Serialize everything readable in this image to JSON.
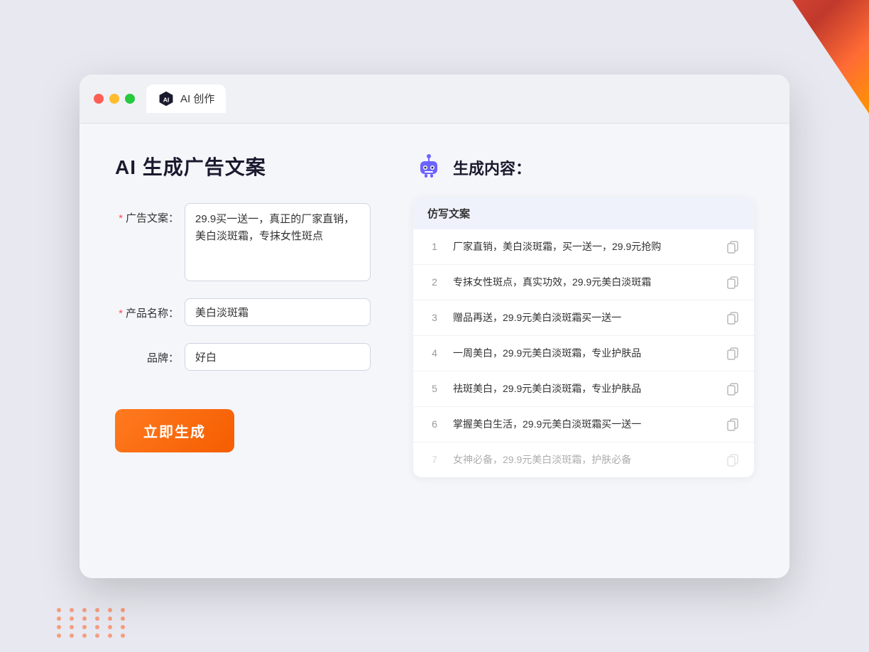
{
  "window": {
    "title": "AI 创作",
    "tab_title": "AI 创作"
  },
  "page": {
    "title": "AI 生成广告文案",
    "result_title": "生成内容："
  },
  "form": {
    "ad_copy_label": "广告文案：",
    "ad_copy_required": "＊",
    "ad_copy_value": "29.9买一送一，真正的厂家直销，美白淡斑霜，专抹女性斑点",
    "product_name_label": "产品名称：",
    "product_name_required": "＊",
    "product_name_value": "美白淡斑霜",
    "brand_label": "品牌：",
    "brand_value": "好白",
    "submit_label": "立即生成"
  },
  "results": {
    "table_header": "仿写文案",
    "rows": [
      {
        "num": "1",
        "text": "厂家直销，美白淡斑霜，买一送一，29.9元抢购",
        "faded": false
      },
      {
        "num": "2",
        "text": "专抹女性斑点，真实功效，29.9元美白淡斑霜",
        "faded": false
      },
      {
        "num": "3",
        "text": "赠品再送，29.9元美白淡斑霜买一送一",
        "faded": false
      },
      {
        "num": "4",
        "text": "一周美白，29.9元美白淡斑霜，专业护肤品",
        "faded": false
      },
      {
        "num": "5",
        "text": "祛斑美白，29.9元美白淡斑霜，专业护肤品",
        "faded": false
      },
      {
        "num": "6",
        "text": "掌握美白生活，29.9元美白淡斑霜买一送一",
        "faded": false
      },
      {
        "num": "7",
        "text": "女神必备，29.9元美白淡斑霜，护肤必备",
        "faded": true
      }
    ]
  }
}
